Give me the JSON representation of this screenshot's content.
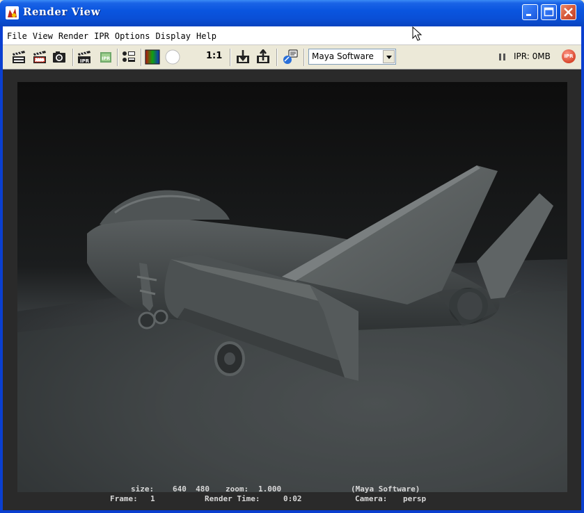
{
  "window": {
    "title": "Render View"
  },
  "menu": [
    "File",
    "View",
    "Render",
    "IPR",
    "Options",
    "Display",
    "Help"
  ],
  "toolbar": {
    "icons": [
      "redo-previous-render-icon",
      "render-region-icon",
      "snapshot-icon",
      "redo-ipr-icon",
      "ipr-refresh-icon",
      "render-settings-icon",
      "rgb-channels-icon",
      "alpha-channel-icon",
      "keep-image-icon",
      "remove-image-icon",
      "render-diagnostics-icon"
    ],
    "one_to_one": "1:1",
    "renderer": "Maya Software",
    "ipr_status": "IPR: 0MB",
    "ipr_badge": "IPR"
  },
  "render_info": {
    "size_label": "size:",
    "size_value": "640  480",
    "zoom_label": "zoom:",
    "zoom_value": "1.000",
    "renderer": "(Maya Software)",
    "frame_label": "Frame:",
    "frame_value": "1",
    "time_label": "Render Time:",
    "time_value": "0:02",
    "camera_label": "Camera:",
    "camera_value": "persp"
  },
  "colors": {
    "titlebar": "#0a55df",
    "client_bg": "#2a2a2a",
    "toolbar_bg": "#ece9d8"
  }
}
